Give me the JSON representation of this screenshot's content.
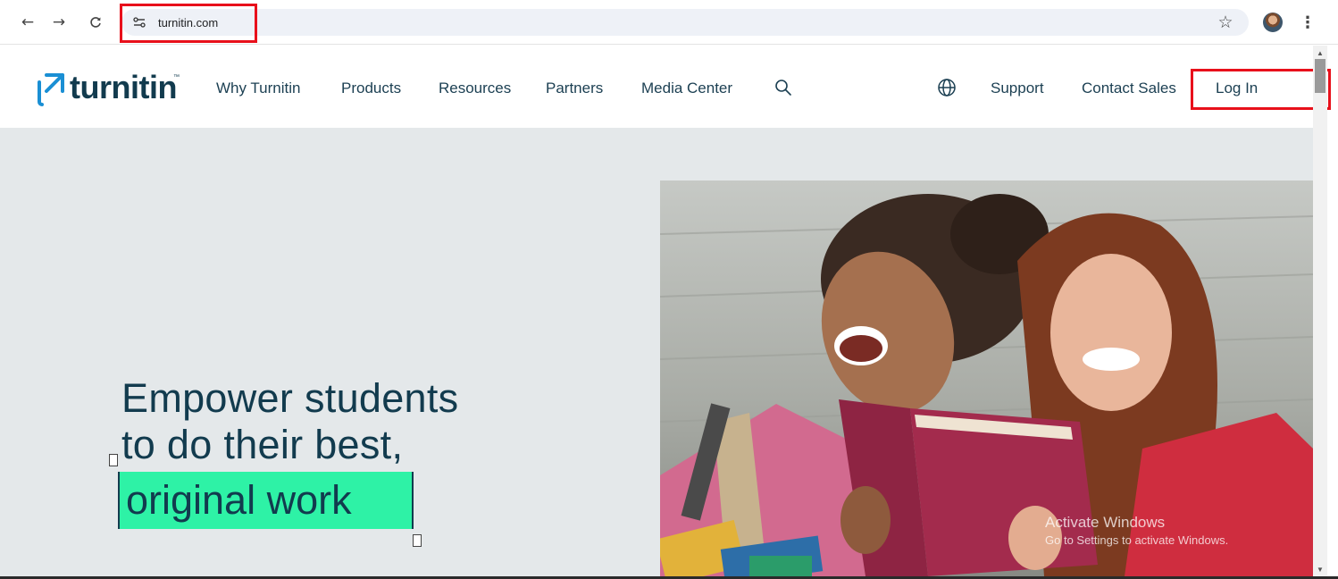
{
  "browser": {
    "url": "turnitin.com",
    "icons": {
      "back": "back-arrow-icon",
      "forward": "forward-arrow-icon",
      "reload": "reload-icon",
      "site_info": "site-info-icon",
      "bookmark": "star-icon",
      "menu": "more-vert-icon"
    }
  },
  "header": {
    "logo_text": "turnitin",
    "logo_tm": "™",
    "nav_items": [
      "Why Turnitin",
      "Products",
      "Resources",
      "Partners",
      "Media Center"
    ],
    "search_icon": "search-icon",
    "globe_icon": "globe-icon",
    "support_label": "Support",
    "contact_label": "Contact Sales",
    "login_label": "Log In"
  },
  "hero": {
    "line1": "Empower students",
    "line2": "to do their best,",
    "highlight": "original work"
  },
  "windows_watermark": {
    "title": "Activate Windows",
    "subtitle": "Go to Settings to activate Windows."
  },
  "colors": {
    "brand_navy": "#123b4e",
    "brand_blue": "#1a8fd4",
    "highlight_green": "#2ef2a6",
    "hero_background": "#e4e8ea",
    "annotation_red": "#e8101b"
  }
}
